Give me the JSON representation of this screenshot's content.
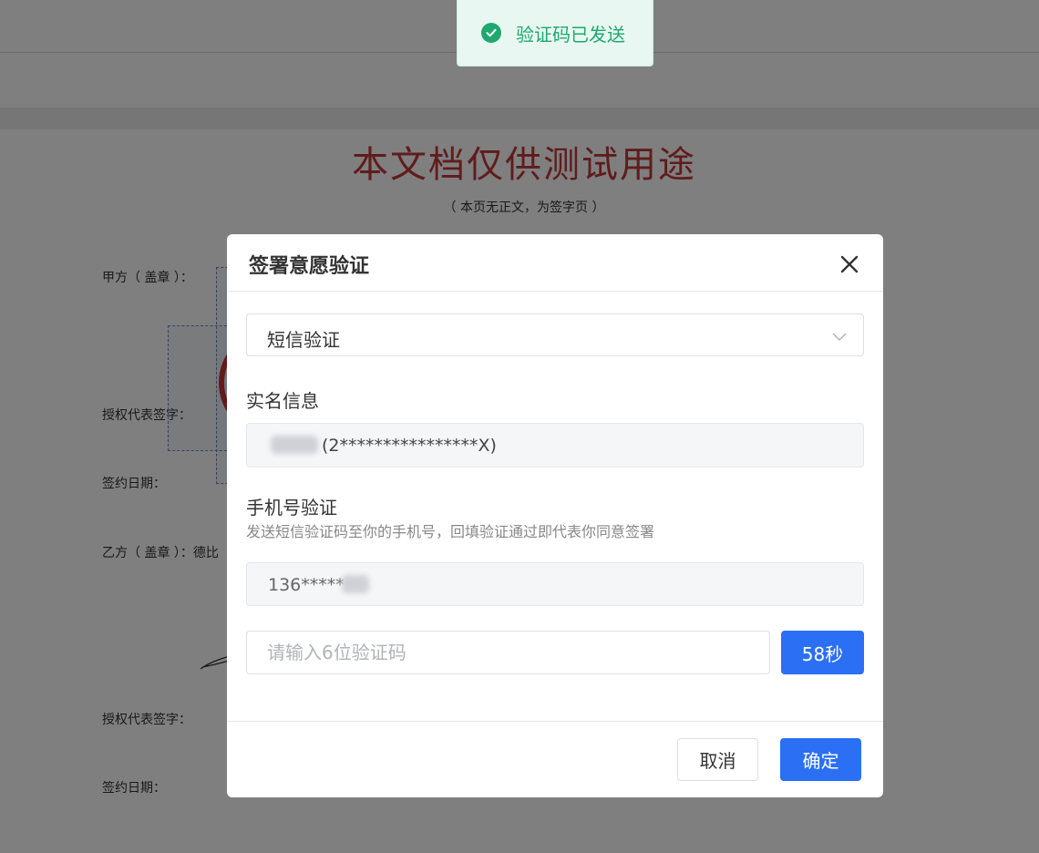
{
  "toast": {
    "message": "验证码已发送",
    "icon": "check-circle-icon",
    "color": "#1fa870"
  },
  "document": {
    "title": "本文档仅供测试用途",
    "subtitle": "（ 本页无正文，为签字页 ）",
    "party_a_label": "甲方（ 盖章 ）：",
    "party_a_rep_label": "授权代表签字：",
    "party_a_date_label": "签约日期：",
    "party_b_label": "乙方（ 盖章 ）：德比",
    "party_b_rep_label": "授权代表签字：",
    "party_b_date_label": "签约日期："
  },
  "dialog": {
    "title": "签署意愿验证",
    "close_icon": "close-icon",
    "method_select": {
      "value": "短信验证"
    },
    "real_name": {
      "label": "实名信息",
      "value": "(2****************X)"
    },
    "phone": {
      "label": "手机号验证",
      "description": "发送短信验证码至你的手机号，回填验证通过即代表你同意签署",
      "value": "136*****"
    },
    "code_input": {
      "placeholder": "请输入6位验证码",
      "value": ""
    },
    "countdown_label": "58秒",
    "cancel_label": "取消",
    "confirm_label": "确定"
  },
  "colors": {
    "primary": "#2b6ff5",
    "success": "#1fa870",
    "title_red": "#c0393b"
  }
}
